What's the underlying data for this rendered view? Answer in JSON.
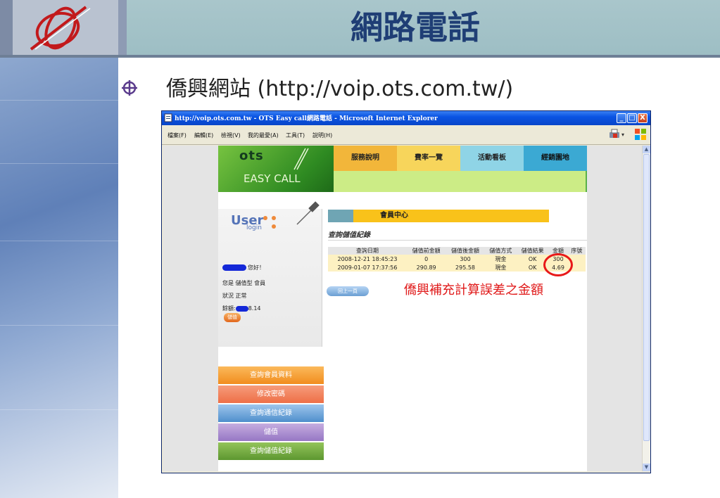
{
  "slide": {
    "title": "網路電話",
    "bullet": "僑興網站 (http://voip.ots.com.tw/)",
    "annotation": "僑興補充計算誤差之金額"
  },
  "browser": {
    "title": "http://voip.ots.com.tw - OTS Easy call網路電話 - Microsoft Internet Explorer",
    "menu": [
      "檔案(F)",
      "編輯(E)",
      "檢視(V)",
      "我的最愛(A)",
      "工具(T)",
      "說明(H)"
    ],
    "window_buttons": {
      "minimize": "_",
      "maximize": "□",
      "close": "X"
    }
  },
  "site": {
    "logo_text": "ots",
    "logo_sub": "EASY CALL",
    "nav": [
      "服務說明",
      "費率一覽",
      "活動看板",
      "經銷園地"
    ],
    "user_logo": "User",
    "user_logo_sub": "login",
    "greeting": "您好！",
    "member_type": "您是 儲值型 會員",
    "status": "狀況 正常",
    "balance_label": "餘額:",
    "balance_value": "8.14",
    "store_button": "儲值",
    "side_menu": [
      "查詢會員資料",
      "修改密碼",
      "查詢通信紀錄",
      "儲值",
      "查詢儲值紀錄"
    ],
    "member_center": "會員中心",
    "section_title": "查詢儲值紀錄",
    "table": {
      "headers": [
        "查詢日期",
        "儲值前金額",
        "儲值後金額",
        "儲值方式",
        "儲值結果",
        "金額",
        "序號"
      ],
      "rows": [
        [
          "2008-12-21 18:45:23",
          "0",
          "300",
          "現金",
          "OK",
          "300",
          ""
        ],
        [
          "2009-01-07 17:37:56",
          "290.89",
          "295.58",
          "現金",
          "OK",
          "4.69",
          ""
        ]
      ]
    },
    "back_button": "回上一頁"
  },
  "colors": {
    "slide_title": "#1f3e75",
    "annotation": "#e01818",
    "highlight_ring": "#e81919"
  }
}
